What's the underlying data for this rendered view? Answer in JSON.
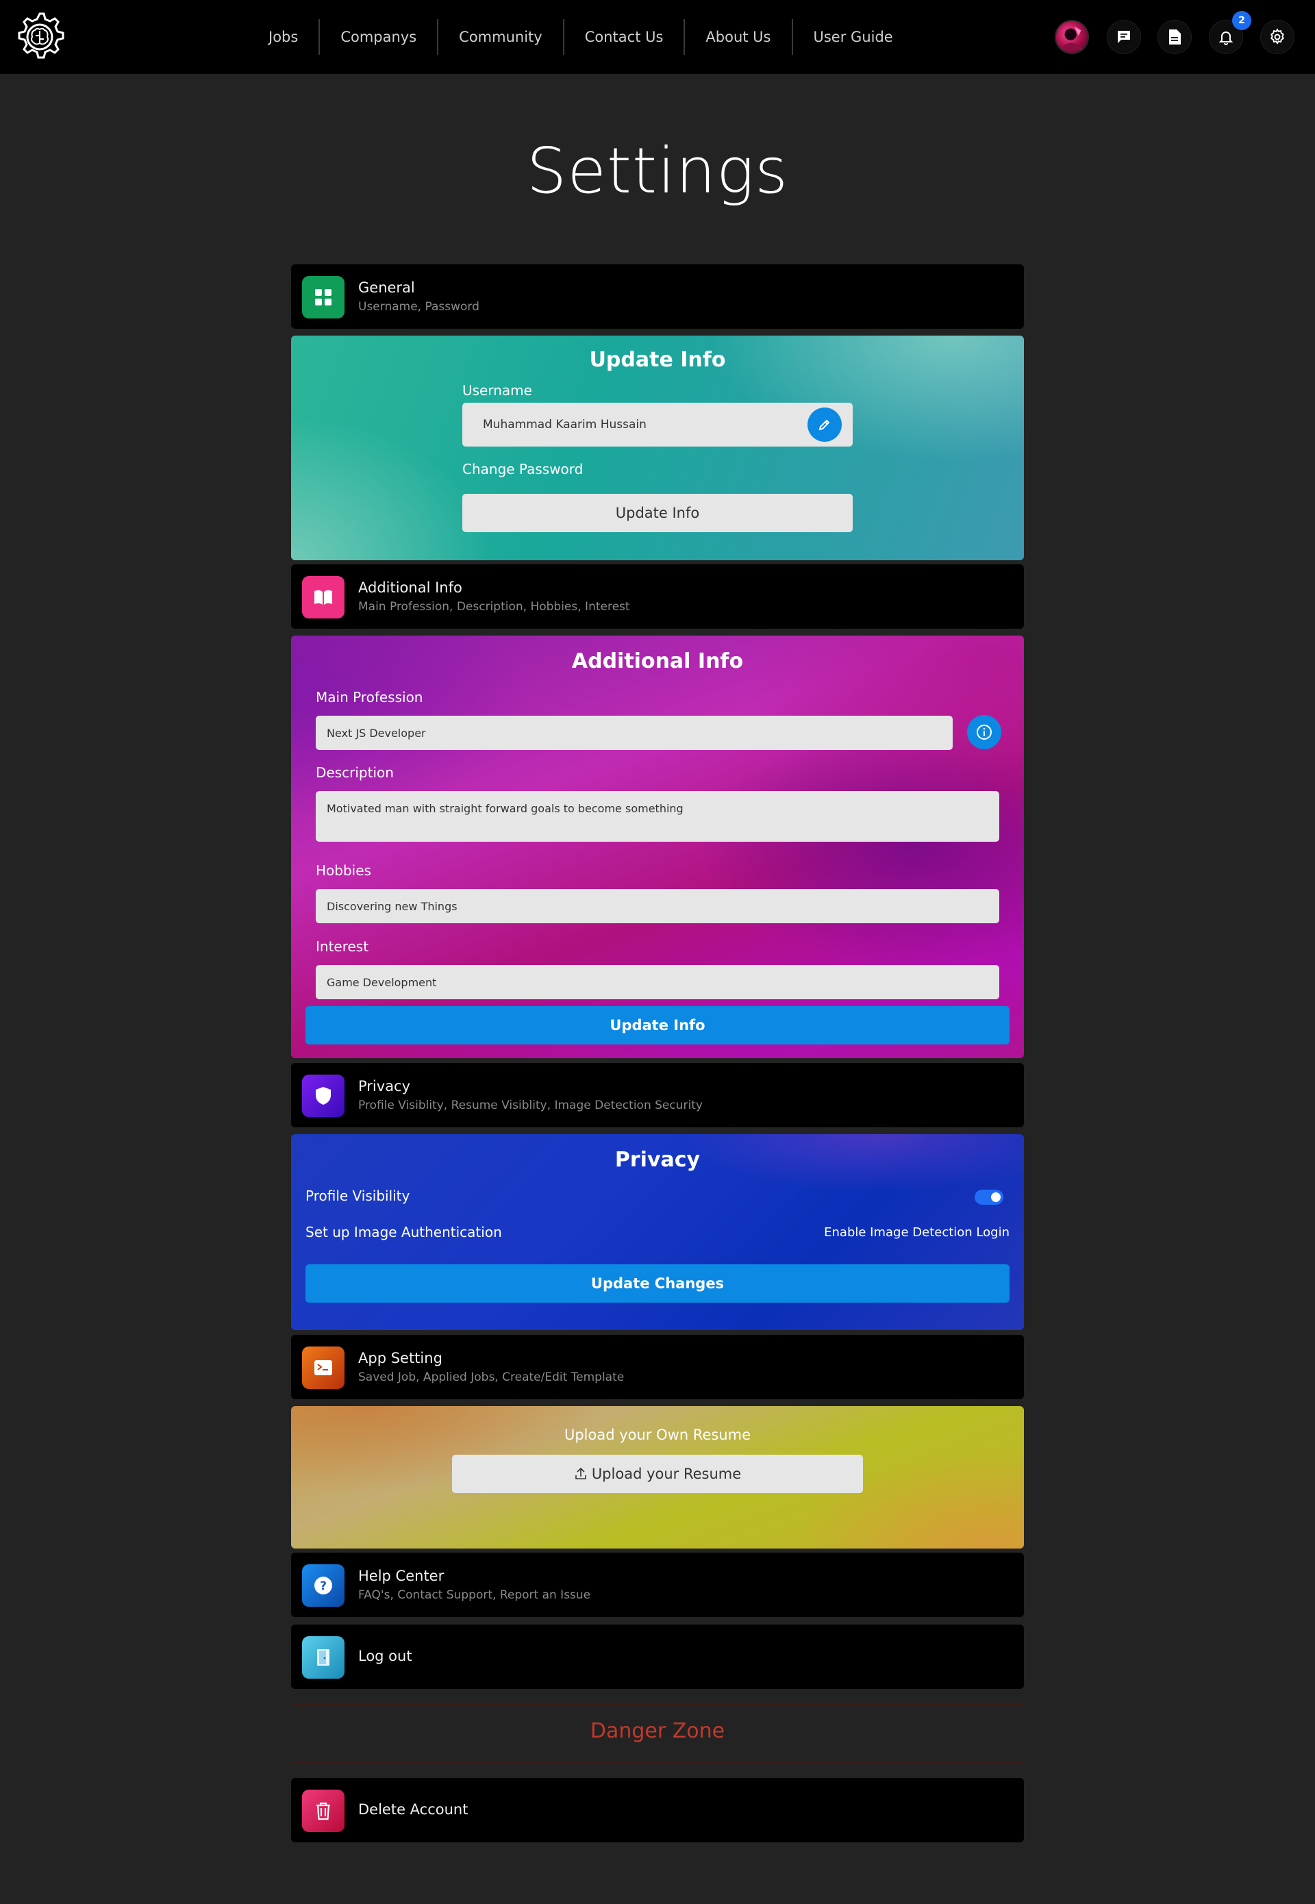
{
  "navbar": {
    "links": [
      "Jobs",
      "Companys",
      "Community",
      "Contact Us",
      "About Us",
      "User Guide"
    ],
    "notification_count": "2",
    "icons": [
      "avatar",
      "chat-icon",
      "document-icon",
      "bell-icon",
      "gear-icon"
    ]
  },
  "page": {
    "title": "Settings"
  },
  "sections": {
    "general": {
      "title": "General",
      "subtitle": "Username, Password",
      "icon": "grid-icon",
      "color": "#0f9d58"
    },
    "update_info": {
      "heading": "Update Info",
      "username_label": "Username",
      "username_value": "Muhammad Kaarim Hussain",
      "change_password_label": "Change Password",
      "button": "Update Info"
    },
    "additional": {
      "title": "Additional Info",
      "subtitle": "Main Profession, Description, Hobbies, Interest",
      "icon": "book-icon",
      "color": "#ee2f82"
    },
    "additional_form": {
      "heading": "Additional Info",
      "main_profession_label": "Main Profession",
      "main_profession_value": "Next JS Developer",
      "description_label": "Description",
      "description_value": "Motivated man with straight forward goals to become something",
      "hobbies_label": "Hobbies",
      "hobbies_value": "Discovering new Things",
      "interest_label": "Interest",
      "interest_value": "Game Development",
      "button": "Update Info"
    },
    "privacy": {
      "title": "Privacy",
      "subtitle": "Profile Visiblity, Resume Visiblity, Image Detection Security",
      "icon": "shield-icon",
      "color": "#5a14d8"
    },
    "privacy_form": {
      "heading": "Privacy",
      "profile_visibility_label": "Profile Visibility",
      "profile_visibility_on": true,
      "image_auth_label": "Set up Image Authentication",
      "image_detection_link": "Enable Image Detection Login",
      "button": "Update Changes"
    },
    "app_setting": {
      "title": "App Setting",
      "subtitle": "Saved Job, Applied Jobs, Create/Edit Template",
      "icon": "terminal-icon",
      "color": "#e2561a"
    },
    "resume": {
      "heading": "Upload your Own Resume",
      "button": "Upload your Resume"
    },
    "help": {
      "title": "Help Center",
      "subtitle": "FAQ's, Contact Support, Report an Issue",
      "icon": "question-icon",
      "color": "#1a6fd6"
    },
    "logout": {
      "title": "Log out",
      "icon": "door-icon",
      "color": "#3ab0d6"
    },
    "danger": {
      "title": "Danger Zone"
    },
    "delete": {
      "title": "Delete Account",
      "icon": "trash-icon",
      "color": "#e3195f"
    }
  }
}
